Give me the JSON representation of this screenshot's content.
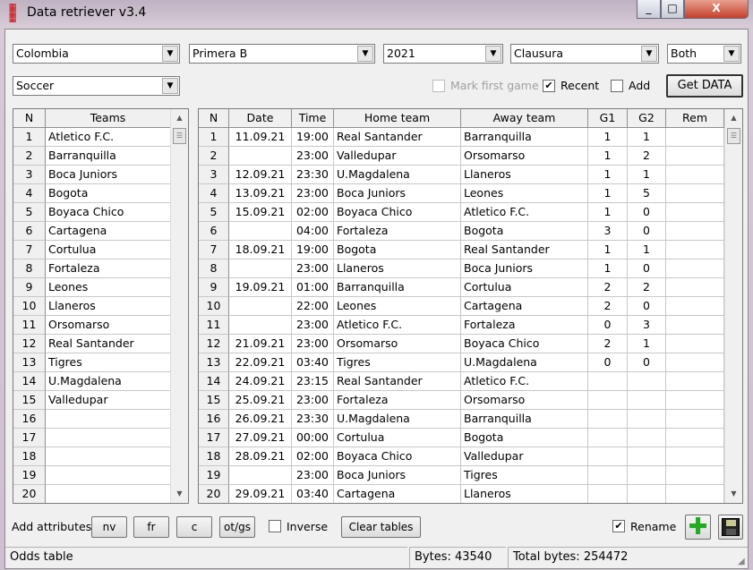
{
  "window": {
    "title": "Data retriever v3.4",
    "minimize": "_",
    "maximize": "□",
    "close": "X"
  },
  "filters": {
    "country": "Colombia",
    "league": "Primera B",
    "year": "2021",
    "stage": "Clausura",
    "side": "Both",
    "sport": "Soccer"
  },
  "options": {
    "mark_first_game": {
      "label": "Mark first game",
      "checked": false,
      "disabled": true
    },
    "recent": {
      "label": "Recent",
      "checked": true
    },
    "add": {
      "label": "Add",
      "checked": false
    }
  },
  "get_data_label": "Get DATA",
  "teams_table": {
    "columns": [
      "N",
      "Teams"
    ],
    "rows": [
      [
        "1",
        "Atletico F.C."
      ],
      [
        "2",
        "Barranquilla"
      ],
      [
        "3",
        "Boca Juniors"
      ],
      [
        "4",
        "Bogota"
      ],
      [
        "5",
        "Boyaca Chico"
      ],
      [
        "6",
        "Cartagena"
      ],
      [
        "7",
        "Cortulua"
      ],
      [
        "8",
        "Fortaleza"
      ],
      [
        "9",
        "Leones"
      ],
      [
        "10",
        "Llaneros"
      ],
      [
        "11",
        "Orsomarso"
      ],
      [
        "12",
        "Real Santander"
      ],
      [
        "13",
        "Tigres"
      ],
      [
        "14",
        "U.Magdalena"
      ],
      [
        "15",
        "Valledupar"
      ],
      [
        "16",
        ""
      ],
      [
        "17",
        ""
      ],
      [
        "18",
        ""
      ],
      [
        "19",
        ""
      ],
      [
        "20",
        ""
      ]
    ]
  },
  "matches_table": {
    "columns": [
      "N",
      "Date",
      "Time",
      "Home team",
      "Away team",
      "G1",
      "G2",
      "Rem"
    ],
    "rows": [
      [
        "1",
        "11.09.21",
        "19:00",
        "Real Santander",
        "Barranquilla",
        "1",
        "1",
        ""
      ],
      [
        "2",
        "",
        "23:00",
        "Valledupar",
        "Orsomarso",
        "1",
        "2",
        ""
      ],
      [
        "3",
        "12.09.21",
        "23:30",
        "U.Magdalena",
        "Llaneros",
        "1",
        "1",
        ""
      ],
      [
        "4",
        "13.09.21",
        "23:00",
        "Boca Juniors",
        "Leones",
        "1",
        "5",
        ""
      ],
      [
        "5",
        "15.09.21",
        "02:00",
        "Boyaca Chico",
        "Atletico F.C.",
        "1",
        "0",
        ""
      ],
      [
        "6",
        "",
        "04:00",
        "Fortaleza",
        "Bogota",
        "3",
        "0",
        ""
      ],
      [
        "7",
        "18.09.21",
        "19:00",
        "Bogota",
        "Real Santander",
        "1",
        "1",
        ""
      ],
      [
        "8",
        "",
        "23:00",
        "Llaneros",
        "Boca Juniors",
        "1",
        "0",
        ""
      ],
      [
        "9",
        "19.09.21",
        "01:00",
        "Barranquilla",
        "Cortulua",
        "2",
        "2",
        ""
      ],
      [
        "10",
        "",
        "22:00",
        "Leones",
        "Cartagena",
        "2",
        "0",
        ""
      ],
      [
        "11",
        "",
        "23:00",
        "Atletico F.C.",
        "Fortaleza",
        "0",
        "3",
        ""
      ],
      [
        "12",
        "21.09.21",
        "23:00",
        "Orsomarso",
        "Boyaca Chico",
        "2",
        "1",
        ""
      ],
      [
        "13",
        "22.09.21",
        "03:40",
        "Tigres",
        "U.Magdalena",
        "0",
        "0",
        ""
      ],
      [
        "14",
        "24.09.21",
        "23:15",
        "Real Santander",
        "Atletico F.C.",
        "",
        "",
        " "
      ],
      [
        "15",
        "25.09.21",
        "23:00",
        "Fortaleza",
        "Orsomarso",
        "",
        "",
        ""
      ],
      [
        "16",
        "26.09.21",
        "23:30",
        "U.Magdalena",
        "Barranquilla",
        "",
        "",
        ""
      ],
      [
        "17",
        "27.09.21",
        "00:00",
        "Cortulua",
        "Bogota",
        "",
        "",
        ""
      ],
      [
        "18",
        "28.09.21",
        "02:00",
        "Boyaca Chico",
        "Valledupar",
        "",
        "",
        ""
      ],
      [
        "19",
        "",
        "23:00",
        "Boca Juniors",
        "Tigres",
        "",
        "",
        ""
      ],
      [
        "20",
        "29.09.21",
        "03:40",
        "Cartagena",
        "Llaneros",
        "",
        "",
        ""
      ]
    ]
  },
  "bottom": {
    "add_attributes_label": "Add attributes:",
    "attr_buttons": [
      "nv",
      "fr",
      "c",
      "ot/gs"
    ],
    "inverse": {
      "label": "Inverse",
      "checked": false
    },
    "clear_tables": "Clear tables",
    "rename": {
      "label": "Rename",
      "checked": true
    }
  },
  "status": {
    "left": "Odds table",
    "bytes": "Bytes: 43540",
    "total": "Total bytes: 254472"
  },
  "colors": {
    "add_icon": "#22aa22",
    "save_icon": "#222222",
    "window_bg": "#f0f0f0"
  }
}
